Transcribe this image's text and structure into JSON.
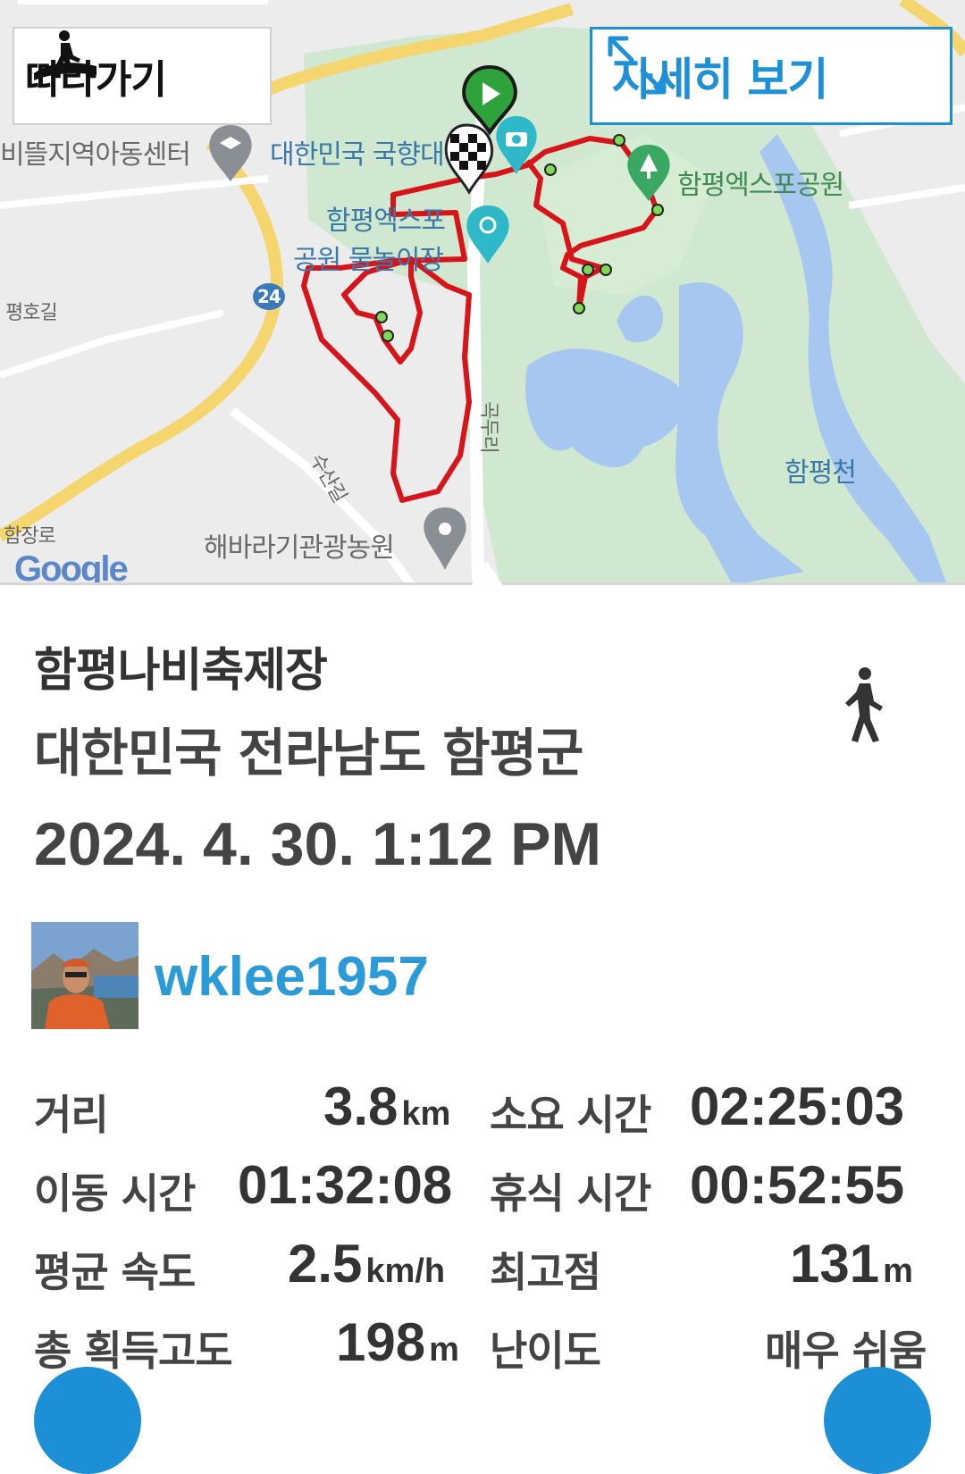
{
  "map": {
    "follow_label": "따라가기",
    "detail_label": "자세히 보기",
    "labels": {
      "community_center": "비뜰지역아동센터",
      "national": "대한민국 국향대",
      "expo_park": "함평엑스포공원",
      "expo_water_1": "함평엑스포",
      "expo_water_2": "공원 물놀이장",
      "pyeongho": "평호길",
      "route_no": "24",
      "susan": "수산길",
      "hamjang": "함장로",
      "sunflower": "해바라기관광농원",
      "hampyeong_stream": "함평천",
      "vertical_road": "곡두리"
    },
    "google": "Google",
    "route_color": "#d8141b",
    "park_color": "#cfe8cf",
    "water_color": "#a6c8f0"
  },
  "place": {
    "name": "함평나비축제장",
    "region": "대한민국 전라남도 함평군",
    "datetime": "2024. 4. 30. 1:12 PM"
  },
  "user": {
    "name": "wklee1957"
  },
  "stats": {
    "distance_label": "거리",
    "distance_value": "3.8",
    "distance_unit": "km",
    "duration_label": "소요 시간",
    "duration_value": "02:25:03",
    "moving_label": "이동 시간",
    "moving_value": "01:32:08",
    "rest_label": "휴식 시간",
    "rest_value": "00:52:55",
    "speed_label": "평균 속도",
    "speed_value": "2.5",
    "speed_unit": "km/h",
    "max_alt_label": "최고점",
    "max_alt_value": "131",
    "max_alt_unit": "m",
    "gain_label": "총 획득고도",
    "gain_value": "198",
    "gain_unit": "m",
    "difficulty_label": "난이도",
    "difficulty_value": "매우 쉬움"
  }
}
